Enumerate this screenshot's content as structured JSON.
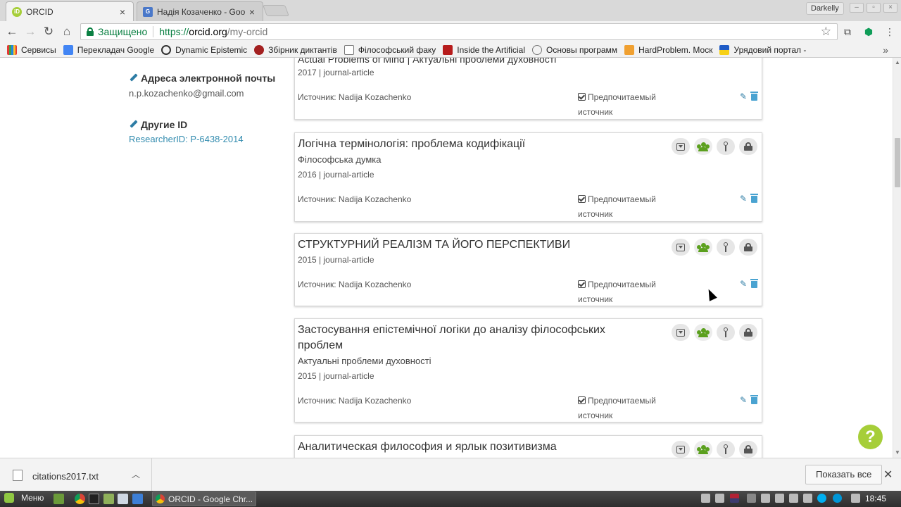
{
  "browser": {
    "tabs": [
      {
        "title": "ORCID",
        "active": true
      },
      {
        "title": "Надія Козаченко - Goo",
        "active": false
      }
    ],
    "profile_name": "Darkelly",
    "omnibox": {
      "secure_label": "Защищено",
      "url_scheme": "https://",
      "url_host": "orcid.org",
      "url_path": "/my-orcid"
    },
    "bookmarks": [
      {
        "label": "Сервисы"
      },
      {
        "label": "Перекладач Google"
      },
      {
        "label": "Dynamic Epistemic"
      },
      {
        "label": "Збірник диктантів"
      },
      {
        "label": "Філософський факу"
      },
      {
        "label": "Inside the Artificial"
      },
      {
        "label": "Основы программ"
      },
      {
        "label": "HardProblem. Моск"
      },
      {
        "label": "Урядовий портал -"
      }
    ]
  },
  "sidebar": {
    "email_heading": "Адреса электронной почты",
    "email_value": "n.p.kozachenko@gmail.com",
    "other_ids_heading": "Другие ID",
    "researcher_id": "ResearcherID: P-6438-2014"
  },
  "works": {
    "partial_top": {
      "title_fragment": "Actual Problems of Mind | Актуальні проблеми духовності",
      "meta": "2017 | journal-article",
      "source": "Источник: Nadija Kozachenko",
      "preferred": "Предпочитаемый источник"
    },
    "items": [
      {
        "title": "Логічна термінологія: проблема кодифікації",
        "journal": "Філософська думка",
        "meta": "2016 | journal-article",
        "source": "Источник: Nadija Kozachenko",
        "preferred": "Предпочитаемый источник"
      },
      {
        "title": "СТРУКТУРНИЙ РЕАЛІЗМ ТА ЙОГО ПЕРСПЕКТИВИ",
        "journal": "",
        "meta": "2015 | journal-article",
        "source": "Источник: Nadija Kozachenko",
        "preferred": "Предпочитаемый источник"
      },
      {
        "title": "Застосування епістемічної логіки до аналізу філософських проблем",
        "journal": "Актуальні проблеми духовності",
        "meta": "2015 | journal-article",
        "source": "Источник: Nadija Kozachenko",
        "preferred": "Предпочитаемый источник"
      },
      {
        "title": "Аналитическая философия и ярлык позитивизма",
        "journal": "",
        "meta": "",
        "source": "",
        "preferred": ""
      }
    ],
    "help_label": "?"
  },
  "downloads": {
    "file_name": "citations2017.txt",
    "show_all": "Показать все"
  },
  "taskbar": {
    "menu_label": "Меню",
    "window_title": "ORCID - Google Chr...",
    "clock": "18:45"
  },
  "colors": {
    "orcid_green": "#a6ce39",
    "link_blue": "#338caf",
    "secure_green": "#0b8043",
    "everyone_green": "#5ba01e"
  },
  "icons": {
    "privacy": [
      "dropdown-icon",
      "everyone-icon",
      "limited-icon",
      "private-icon"
    ],
    "work_actions": [
      "edit-pencil-icon",
      "delete-trash-icon"
    ]
  }
}
